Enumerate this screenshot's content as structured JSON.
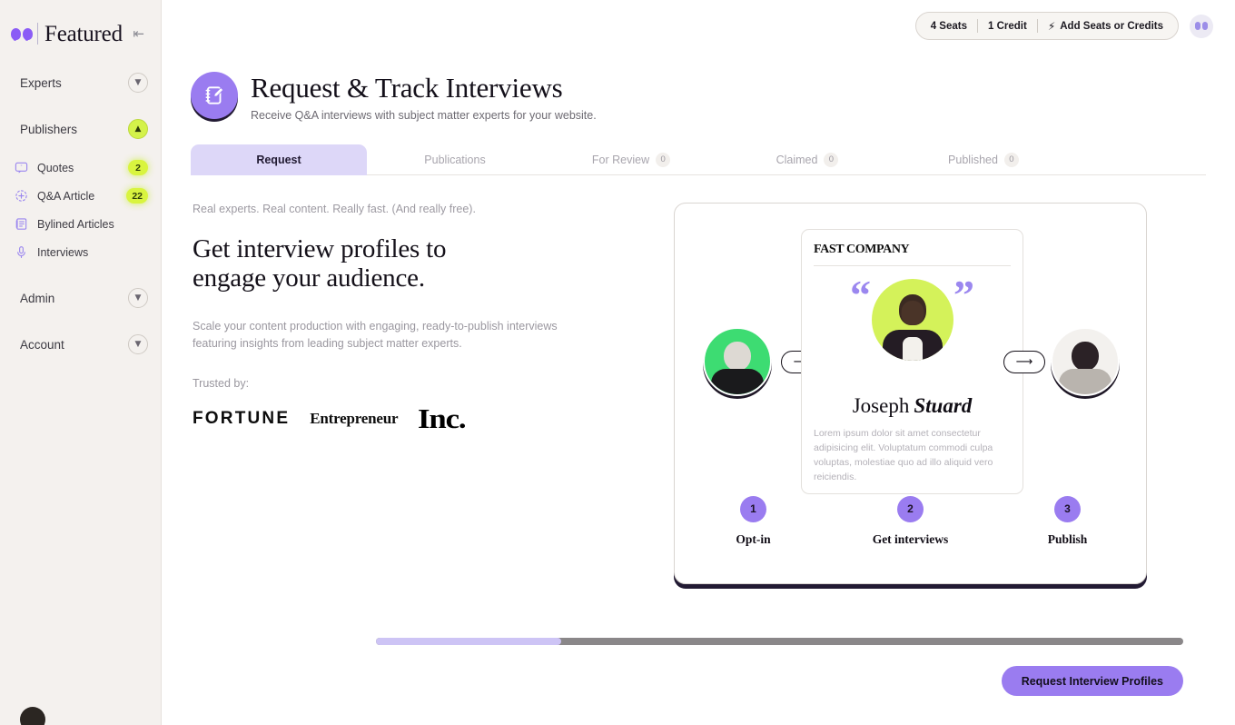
{
  "sidebar": {
    "brand": "Featured",
    "collapse_icon": "collapse-left-icon",
    "groups": [
      {
        "label": "Experts",
        "expanded": false
      },
      {
        "label": "Publishers",
        "expanded": true
      },
      {
        "label": "Admin",
        "expanded": false
      },
      {
        "label": "Account",
        "expanded": false
      }
    ],
    "publisher_items": [
      {
        "label": "Quotes",
        "badge": "2",
        "icon": "quote-bubble-icon"
      },
      {
        "label": "Q&A Article",
        "badge": "22",
        "icon": "qa-circle-icon"
      },
      {
        "label": "Bylined Articles",
        "badge": "",
        "icon": "document-icon"
      },
      {
        "label": "Interviews",
        "badge": "",
        "icon": "microphone-icon"
      }
    ]
  },
  "topbar": {
    "seats": "4 Seats",
    "credits": "1 Credit",
    "add_label": "Add Seats or Credits",
    "bolt_icon": "lightning-bolt-icon",
    "avatar": "user-avatar"
  },
  "header": {
    "icon": "notebook-pencil-icon",
    "title": "Request & Track Interviews",
    "subtitle": "Receive Q&A interviews with subject matter experts for your website."
  },
  "tabs": [
    {
      "label": "Request",
      "count": "",
      "active": true
    },
    {
      "label": "Publications",
      "count": "",
      "active": false
    },
    {
      "label": "For Review",
      "count": "0",
      "active": false
    },
    {
      "label": "Claimed",
      "count": "0",
      "active": false
    },
    {
      "label": "Published",
      "count": "0",
      "active": false
    }
  ],
  "hero": {
    "eyebrow": "Real experts. Real content. Really fast. (And really free).",
    "headline": "Get interview profiles to engage your audience.",
    "body": "Scale your content production with engaging, ready-to-publish interviews featuring insights from leading subject matter experts.",
    "trusted_label": "Trusted by:",
    "logos": [
      "FORTUNE",
      "Entrepreneur",
      "Inc."
    ]
  },
  "illustration": {
    "publication": "FAST COMPANY",
    "expert_first_name": "Joseph",
    "expert_last_name": "Stuard",
    "quote_text": "Lorem ipsum dolor sit amet consectetur adipisicing elit. Voluptatum commodi culpa voluptas, molestiae quo ad illo aliquid vero reiciendis.",
    "arrow_icon": "arrow-right-icon",
    "steps": [
      {
        "num": "1",
        "label": "Opt-in"
      },
      {
        "num": "2",
        "label": "Get interviews"
      },
      {
        "num": "3",
        "label": "Publish"
      }
    ]
  },
  "footer": {
    "progress_percent": "23",
    "cta_label": "Request Interview Profiles"
  },
  "colors": {
    "accent_purple": "#9a7cf0",
    "badge_lime": "#d9f43f",
    "tab_active_bg": "#ddd7f8",
    "sidebar_bg": "#f4f1ee"
  }
}
